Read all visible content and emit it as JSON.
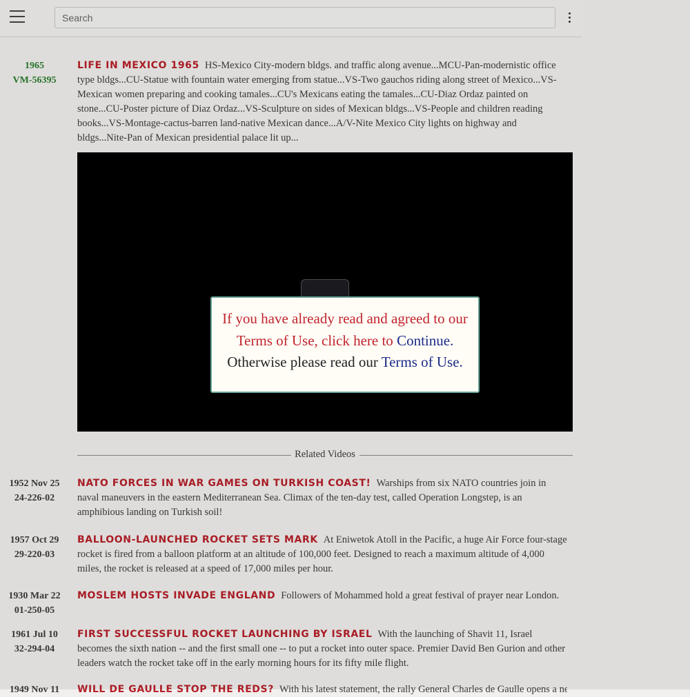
{
  "header": {
    "search_placeholder": "Search"
  },
  "main_entry": {
    "year": "1965",
    "id": "VM-56395",
    "title": "LIFE IN MEXICO 1965",
    "description": "HS-Mexico City-modern bldgs. and traffic along avenue...MCU-Pan-modernistic office type bldgs...CU-Statue with fountain water emerging from statue...VS-Two gauchos riding along street of Mexico...VS-Mexican women preparing and cooking tamales...CU's Mexicans eating the tamales...CU-Diaz Ordaz painted on stone...CU-Poster picture of Diaz Ordaz...VS-Sculpture on sides of Mexican bldgs...VS-People and children reading books...VS-Montage-cactus-barren land-native Mexican dance...A/V-Nite Mexico City lights on highway and bldgs...Nite-Pan of Mexican presidential palace lit up..."
  },
  "modal": {
    "line1_red": "If you have already read and agreed to our",
    "line2_red": "Terms of Use, click here to",
    "continue_link": "Continue.",
    "line3_text": "Otherwise please read our",
    "terms_link": "Terms of Use."
  },
  "related_label": "Related Videos",
  "related": [
    {
      "date": "1952 Nov 25",
      "id": "24-226-02",
      "title": "NATO FORCES IN WAR GAMES ON TURKISH COAST!",
      "description": "Warships from six NATO countries join in naval maneuvers in the eastern Mediterranean Sea. Climax of the ten-day test, called Operation Longstep, is an amphibious landing on Turkish soil!"
    },
    {
      "date": "1957 Oct 29",
      "id": "29-220-03",
      "title": "BALLOON-LAUNCHED ROCKET SETS MARK",
      "description": "At Eniwetok Atoll in the Pacific, a huge Air Force four-stage rocket is fired from a balloon platform at an altitude of 100,000 feet. Designed to reach a maximum altitude of 4,000 miles, the rocket is released at a speed of 17,000 miles per hour."
    },
    {
      "date": "1930 Mar 22",
      "id": "01-250-05",
      "title": "MOSLEM HOSTS INVADE ENGLAND",
      "description": "Followers of Mohammed hold a great festival of prayer near London."
    },
    {
      "date": "1961 Jul 10",
      "id": "32-294-04",
      "title": "FIRST SUCCESSFUL ROCKET LAUNCHING BY ISRAEL",
      "description": "With the launching of Shavit 11, Israel becomes the sixth nation -- and the first small one -- to put a rocket into outer space. Premier David Ben Gurion and other leaders watch the rocket take off in the early morning hours for its fifty mile flight."
    },
    {
      "date": "1949 Nov 11",
      "id": "",
      "title": "WILL DE GAULLE STOP THE REDS?",
      "description": "With his latest statement, the rally General Charles de Gaulle opens a new"
    }
  ]
}
